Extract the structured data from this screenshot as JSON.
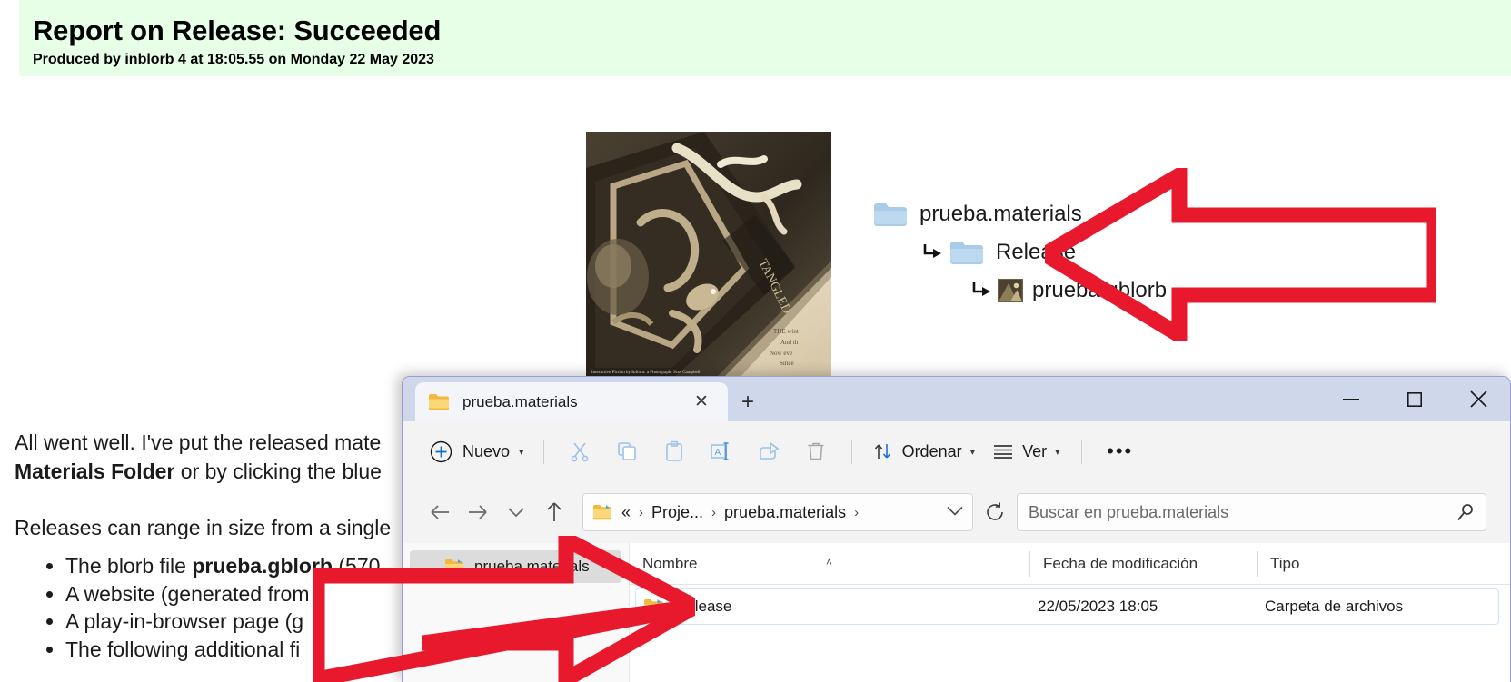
{
  "report": {
    "title": "Report on Release: Succeeded",
    "subtitle": "Produced by inblorb 4 at 18:05.55 on Monday 22 May 2023",
    "banner_color": "#e6ffe6",
    "para1_line1": "All went well. I've put the released mate",
    "para1_line2_bold": "Materials Folder",
    "para1_line2_rest": " or by clicking the blue",
    "para2": "Releases can range in size from a single",
    "right_clipped": "le",
    "bullets": [
      {
        "pre": "The blorb file ",
        "bold": "prueba.gblorb",
        "post": " (570"
      },
      {
        "pre": "A website (generated from",
        "bold": "",
        "post": ""
      },
      {
        "pre": "A play-in-browser page (g",
        "bold": "",
        "post": ""
      },
      {
        "pre": "The following additional fi",
        "bold": "",
        "post": ""
      }
    ]
  },
  "cover": {
    "caption": "Interactive Fiction by Inform: a Photograph: Scot Campbell"
  },
  "tree": {
    "nodes": [
      {
        "label": "prueba.materials",
        "icon": "folder-icon",
        "level": 1
      },
      {
        "label": "Release",
        "icon": "folder-icon",
        "level": 2
      },
      {
        "label": "prueba.gblorb",
        "icon": "blorb-file-icon",
        "level": 3
      }
    ]
  },
  "annotations": {
    "arrow_color": "#e8192c",
    "arrow_top_target": "Release",
    "arrow_bottom_target": "Release row"
  },
  "explorer": {
    "tab": {
      "title": "prueba.materials",
      "close_label": "✕",
      "newtab_label": "+"
    },
    "window_controls": {
      "minimize": "minimize-icon",
      "maximize": "maximize-icon",
      "close": "close-icon"
    },
    "commandbar": {
      "new_label": "Nuevo",
      "icons": [
        "cut-icon",
        "copy-icon",
        "paste-icon",
        "rename-icon",
        "share-icon",
        "delete-icon"
      ],
      "sort_label": "Ordenar",
      "view_label": "Ver",
      "more_label": "•••"
    },
    "address": {
      "back": "back-arrow-icon",
      "forward": "forward-arrow-icon",
      "recent": "chevron-down-icon",
      "up": "up-arrow-icon",
      "crumb_prefix": "«",
      "crumbs": [
        "Proje...",
        "prueba.materials"
      ],
      "crumb_separator": "›",
      "dropdown": "chevron-down-icon",
      "refresh": "refresh-icon"
    },
    "search": {
      "placeholder": "Buscar en prueba.materials",
      "icon": "search-icon"
    },
    "navpane": {
      "items": [
        {
          "label": "prueba.materials",
          "selected": true
        },
        {
          "label": "",
          "selected": false
        }
      ]
    },
    "columns": [
      {
        "key": "name",
        "label": "Nombre",
        "sorted": true,
        "sort_glyph": "˄"
      },
      {
        "key": "date",
        "label": "Fecha de modificación",
        "sorted": false
      },
      {
        "key": "type",
        "label": "Tipo",
        "sorted": false
      }
    ],
    "rows": [
      {
        "name": "Release",
        "date": "22/05/2023 18:05",
        "type": "Carpeta de archivos",
        "icon": "folder-icon"
      }
    ]
  }
}
